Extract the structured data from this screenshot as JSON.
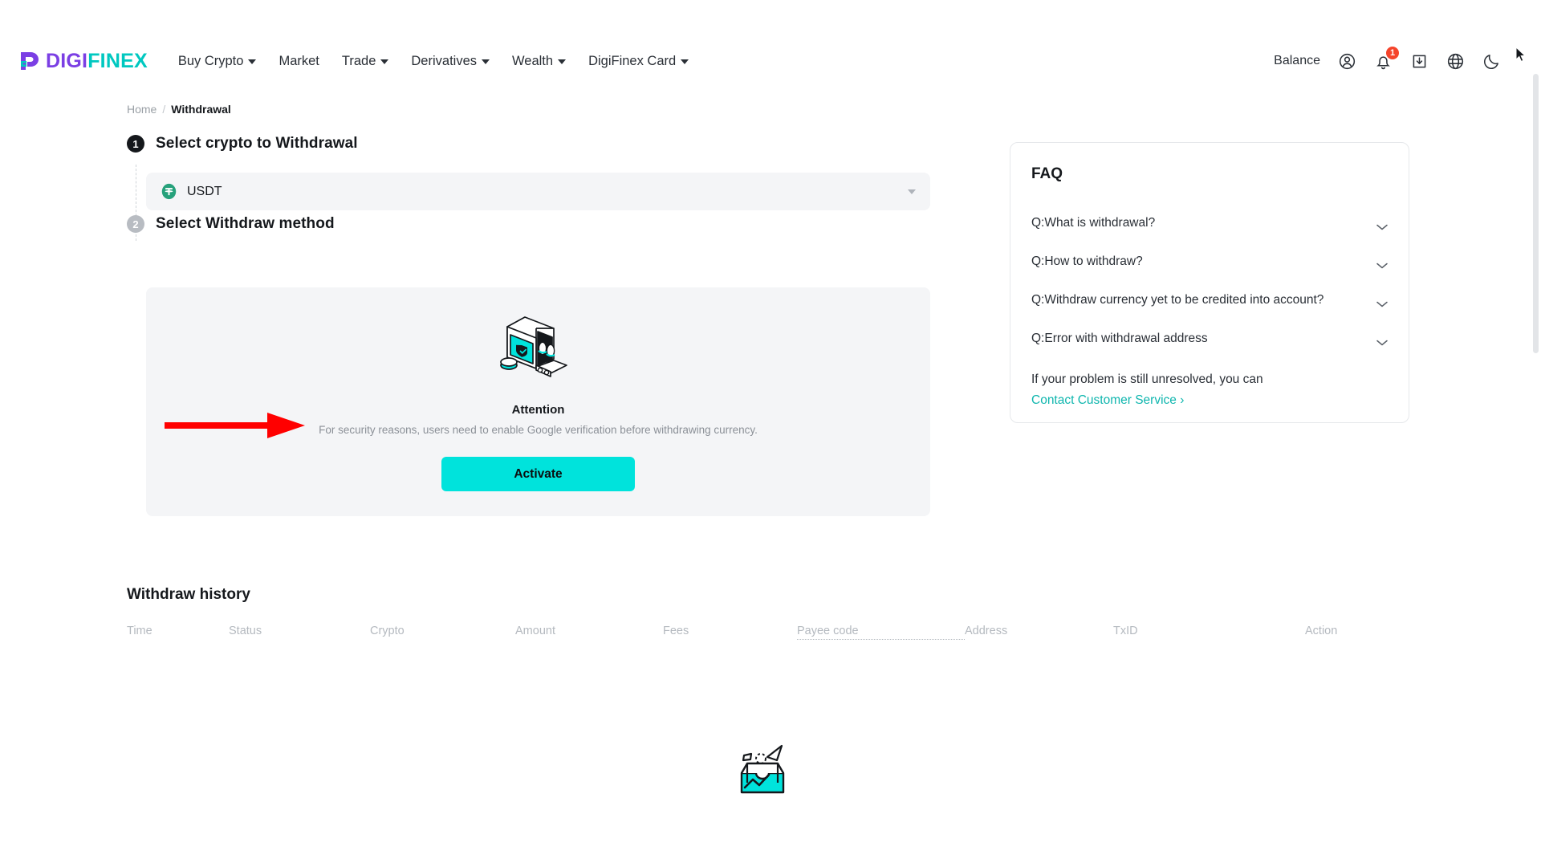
{
  "brand": {
    "name_part1": "DIGI",
    "name_part2": "FINEX",
    "color_purple": "#7B3FE4",
    "color_teal": "#00C8C0"
  },
  "nav": {
    "items": [
      {
        "label": "Buy Crypto",
        "has_caret": true
      },
      {
        "label": "Market",
        "has_caret": false
      },
      {
        "label": "Trade",
        "has_caret": true
      },
      {
        "label": "Derivatives",
        "has_caret": true
      },
      {
        "label": "Wealth",
        "has_caret": true
      },
      {
        "label": "DigiFinex Card",
        "has_caret": true
      }
    ]
  },
  "header_right": {
    "balance_label": "Balance",
    "notification_count": "1",
    "icons": [
      "user-icon",
      "bell-icon",
      "download-icon",
      "globe-icon",
      "moon-icon"
    ]
  },
  "breadcrumb": {
    "home": "Home",
    "separator": "/",
    "current": "Withdrawal"
  },
  "steps": {
    "step1": {
      "number": "1",
      "title": "Select crypto to Withdrawal"
    },
    "step2": {
      "number": "2",
      "title": "Select Withdraw method"
    }
  },
  "crypto_select": {
    "value": "USDT",
    "icon": "usdt-tether-icon",
    "icon_color": "#26A17B"
  },
  "attention": {
    "title": "Attention",
    "description": "For security reasons, users need to enable Google verification before withdrawing currency.",
    "button_label": "Activate",
    "button_color": "#00E3DC",
    "illustration": "safe-robot-shield-illustration"
  },
  "annotation": {
    "arrow": "red-arrow-pointing-right",
    "color": "#FF0000"
  },
  "faq": {
    "title": "FAQ",
    "questions": [
      "Q:What is withdrawal?",
      "Q:How to withdraw?",
      "Q:Withdraw currency yet to be credited into account?",
      "Q:Error with withdrawal address"
    ],
    "footer_text": "If your problem is still unresolved, you can",
    "link_label": "Contact Customer Service ›",
    "link_color": "#0fb6ae"
  },
  "history": {
    "title": "Withdraw history",
    "columns": [
      "Time",
      "Status",
      "Crypto",
      "Amount",
      "Fees",
      "Payee code",
      "Address",
      "TxID",
      "Action"
    ],
    "empty_state_illustration": "empty-box-illustration",
    "rows": []
  }
}
